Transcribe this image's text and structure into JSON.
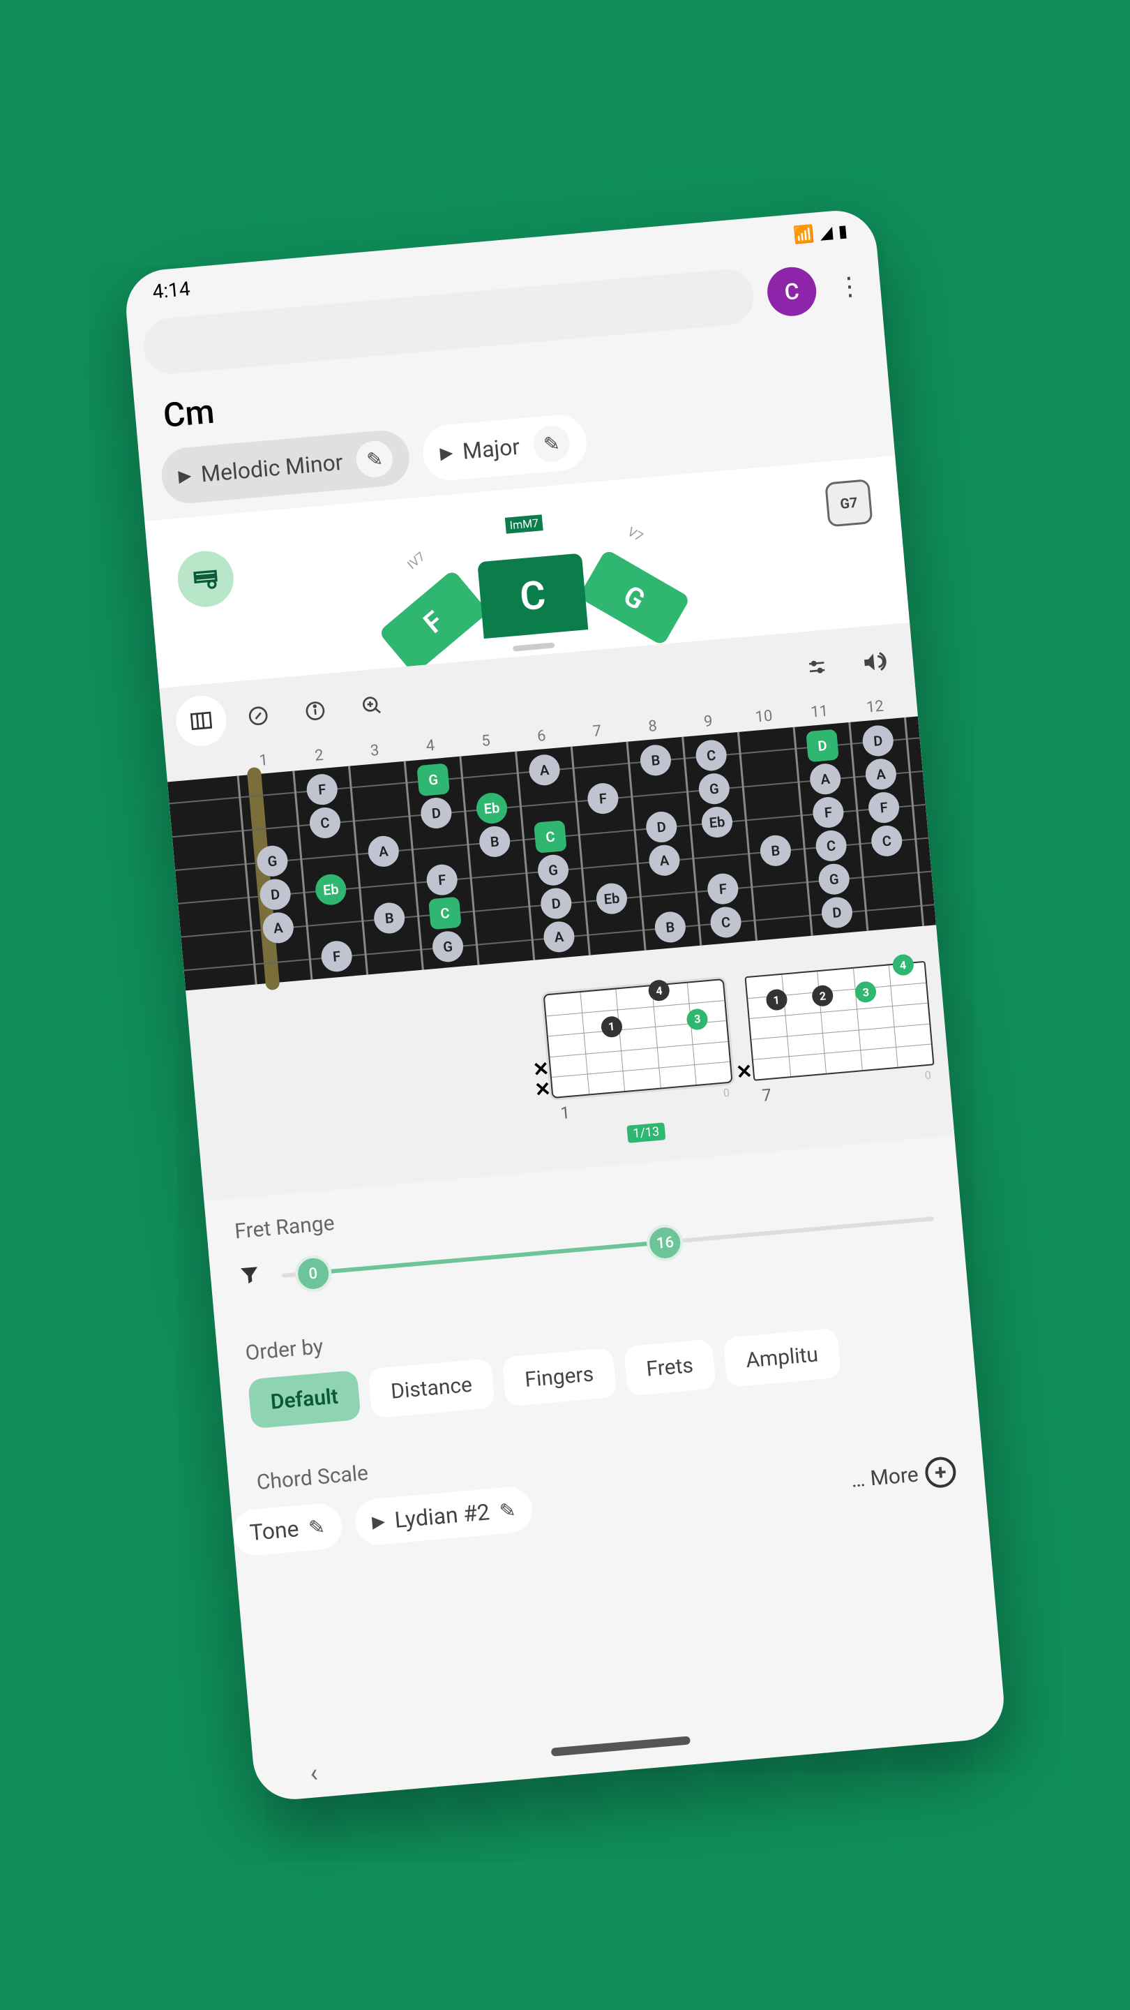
{
  "status": {
    "time": "4:14"
  },
  "avatar_letter": "C",
  "chord_name": "Cm",
  "scale_chips": [
    {
      "label": "Melodic Minor",
      "selected": true
    },
    {
      "label": "Major",
      "selected": false
    }
  ],
  "wheel": {
    "center_label": "ImM7",
    "center_note": "C",
    "left_label": "IV7",
    "left_note": "F",
    "right_label": "V7",
    "right_note": "G"
  },
  "library_label": "G7",
  "fret_numbers": [
    "1",
    "2",
    "3",
    "4",
    "5",
    "6",
    "7",
    "8",
    "9",
    "10",
    "11",
    "12"
  ],
  "fretboard_notes": [
    {
      "s": 1,
      "f": 2,
      "n": "F"
    },
    {
      "s": 1,
      "f": 4,
      "n": "G",
      "root": true
    },
    {
      "s": 1,
      "f": 6,
      "n": "A"
    },
    {
      "s": 1,
      "f": 8,
      "n": "B"
    },
    {
      "s": 1,
      "f": 9,
      "n": "C"
    },
    {
      "s": 1,
      "f": 11,
      "n": "D",
      "root": true
    },
    {
      "s": 1,
      "f": 12,
      "n": "D"
    },
    {
      "s": 2,
      "f": 2,
      "n": "C"
    },
    {
      "s": 2,
      "f": 4,
      "n": "D"
    },
    {
      "s": 2,
      "f": 5,
      "n": "Eb",
      "green": true
    },
    {
      "s": 2,
      "f": 7,
      "n": "F"
    },
    {
      "s": 2,
      "f": 9,
      "n": "G"
    },
    {
      "s": 2,
      "f": 11,
      "n": "A"
    },
    {
      "s": 2,
      "f": 12,
      "n": "A"
    },
    {
      "s": 3,
      "f": 1,
      "n": "G"
    },
    {
      "s": 3,
      "f": 3,
      "n": "A"
    },
    {
      "s": 3,
      "f": 5,
      "n": "B"
    },
    {
      "s": 3,
      "f": 6,
      "n": "C",
      "root": true
    },
    {
      "s": 3,
      "f": 8,
      "n": "D"
    },
    {
      "s": 3,
      "f": 9,
      "n": "Eb"
    },
    {
      "s": 3,
      "f": 11,
      "n": "F"
    },
    {
      "s": 3,
      "f": 12,
      "n": "F"
    },
    {
      "s": 4,
      "f": 1,
      "n": "D"
    },
    {
      "s": 4,
      "f": 2,
      "n": "Eb",
      "green": true
    },
    {
      "s": 4,
      "f": 4,
      "n": "F"
    },
    {
      "s": 4,
      "f": 6,
      "n": "G"
    },
    {
      "s": 4,
      "f": 8,
      "n": "A"
    },
    {
      "s": 4,
      "f": 10,
      "n": "B"
    },
    {
      "s": 4,
      "f": 11,
      "n": "C"
    },
    {
      "s": 4,
      "f": 12,
      "n": "C"
    },
    {
      "s": 5,
      "f": 1,
      "n": "A"
    },
    {
      "s": 5,
      "f": 3,
      "n": "B"
    },
    {
      "s": 5,
      "f": 4,
      "n": "C",
      "root": true
    },
    {
      "s": 5,
      "f": 6,
      "n": "D"
    },
    {
      "s": 5,
      "f": 7,
      "n": "Eb"
    },
    {
      "s": 5,
      "f": 9,
      "n": "F"
    },
    {
      "s": 5,
      "f": 11,
      "n": "G"
    },
    {
      "s": 6,
      "f": 2,
      "n": "F"
    },
    {
      "s": 6,
      "f": 4,
      "n": "G"
    },
    {
      "s": 6,
      "f": 6,
      "n": "A"
    },
    {
      "s": 6,
      "f": 8,
      "n": "B"
    },
    {
      "s": 6,
      "f": 9,
      "n": "C"
    },
    {
      "s": 6,
      "f": 11,
      "n": "D"
    }
  ],
  "chord_diagrams": [
    {
      "start_fret": "1",
      "position": "1/13",
      "selected": true,
      "starting_label_right": "0"
    },
    {
      "start_fret": "7",
      "position": "",
      "selected": false,
      "starting_label_right": "0"
    }
  ],
  "fret_range": {
    "label": "Fret Range",
    "min": "0",
    "max": "16"
  },
  "order_by": {
    "label": "Order by",
    "options": [
      "Default",
      "Distance",
      "Fingers",
      "Frets",
      "Amplitu"
    ],
    "active": "Default"
  },
  "chord_scale": {
    "label": "Chord Scale",
    "chips": [
      {
        "label": "Tone",
        "truncated_left": true
      },
      {
        "label": "Lydian #2",
        "play": true
      }
    ],
    "more_label": "… More"
  }
}
